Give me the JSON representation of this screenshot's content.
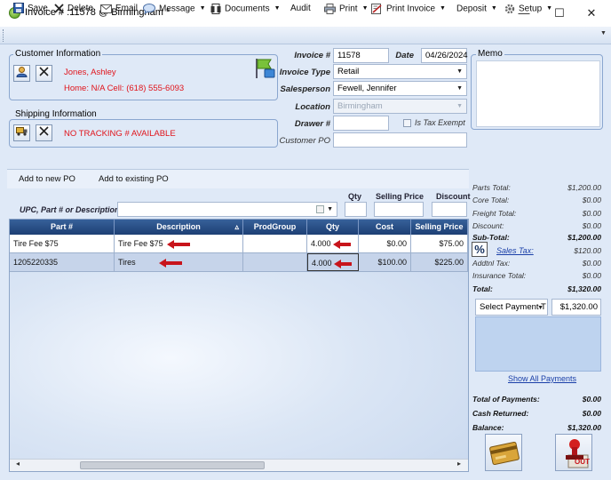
{
  "window": {
    "title": "Invoice # :11578 @ Birmingham *",
    "minimize": "—",
    "maximize": "☐",
    "close": "✕"
  },
  "toolbar": {
    "save": "Save",
    "delete": "Delete",
    "email": "Email",
    "message": "Message",
    "documents": "Documents",
    "audit": "Audit",
    "print": "Print",
    "print_invoice": "Print Invoice",
    "deposit": "Deposit",
    "setup": "Setup"
  },
  "customer": {
    "group_label": "Customer Information",
    "name": "Jones, Ashley",
    "phones": "Home: N/A Cell: (618) 555-6093"
  },
  "shipping": {
    "group_label": "Shipping Information",
    "tracking": "NO TRACKING # AVAILABLE"
  },
  "invoice": {
    "number_label": "Invoice #",
    "number": "11578",
    "date_label": "Date",
    "date": "04/26/2024",
    "type_label": "Invoice Type",
    "type": "Retail",
    "salesperson_label": "Salesperson",
    "salesperson": "Fewell, Jennifer",
    "location_label": "Location",
    "location": "Birmingham",
    "drawer_label": "Drawer #",
    "drawer": "",
    "tax_exempt_label": "Is Tax Exempt",
    "customer_po_label": "Customer PO",
    "customer_po": ""
  },
  "memo": {
    "label": "Memo",
    "text": ""
  },
  "lines": {
    "add_new_po": "Add to new PO",
    "add_existing_po": "Add to existing PO",
    "qty_label": "Qty",
    "selling_price_label": "Selling Price",
    "discount_label": "Discount",
    "upc_label": "UPC, Part # or Description",
    "upc_value": "",
    "columns": [
      "Part #",
      "Description",
      "ProdGroup",
      "Qty",
      "Cost",
      "Selling Price"
    ],
    "sort_indicator": "▵",
    "rows": [
      {
        "part": "Tire Fee $75",
        "description": "Tire Fee $75",
        "prodgroup": "",
        "qty": "4.000",
        "cost": "$0.00",
        "price": "$75.00"
      },
      {
        "part": "1205220335",
        "description": "Tires",
        "prodgroup": "",
        "qty": "4.000",
        "cost": "$100.00",
        "price": "$225.00"
      }
    ]
  },
  "totals": {
    "parts_total_label": "Parts Total:",
    "parts_total": "$1,200.00",
    "core_total_label": "Core Total:",
    "core_total": "$0.00",
    "freight_total_label": "Freight Total:",
    "freight_total": "$0.00",
    "discount_label": "Discount:",
    "discount": "$0.00",
    "subtotal_label": "Sub-Total:",
    "subtotal": "$1,200.00",
    "sales_tax_label": "Sales Tax:",
    "sales_tax": "$120.00",
    "addtl_tax_label": "Addtnl Tax:",
    "addtl_tax": "$0.00",
    "insurance_label": "Insurance Total:",
    "insurance": "$0.00",
    "total_label": "Total:",
    "total": "$1,320.00"
  },
  "payment": {
    "select_label": "Select Payment T",
    "amount": "$1,320.00",
    "show_all": "Show All Payments",
    "total_payments_label": "Total of Payments:",
    "total_payments": "$0.00",
    "cash_returned_label": "Cash Returned:",
    "cash_returned": "$0.00",
    "balance_label": "Balance:",
    "balance": "$1,320.00",
    "checkout_stamp_text": "OUT"
  },
  "colors": {
    "accent_red": "#e0141b",
    "grid_header": "#1d3f74",
    "panel_bg": "#dfe9f7"
  }
}
